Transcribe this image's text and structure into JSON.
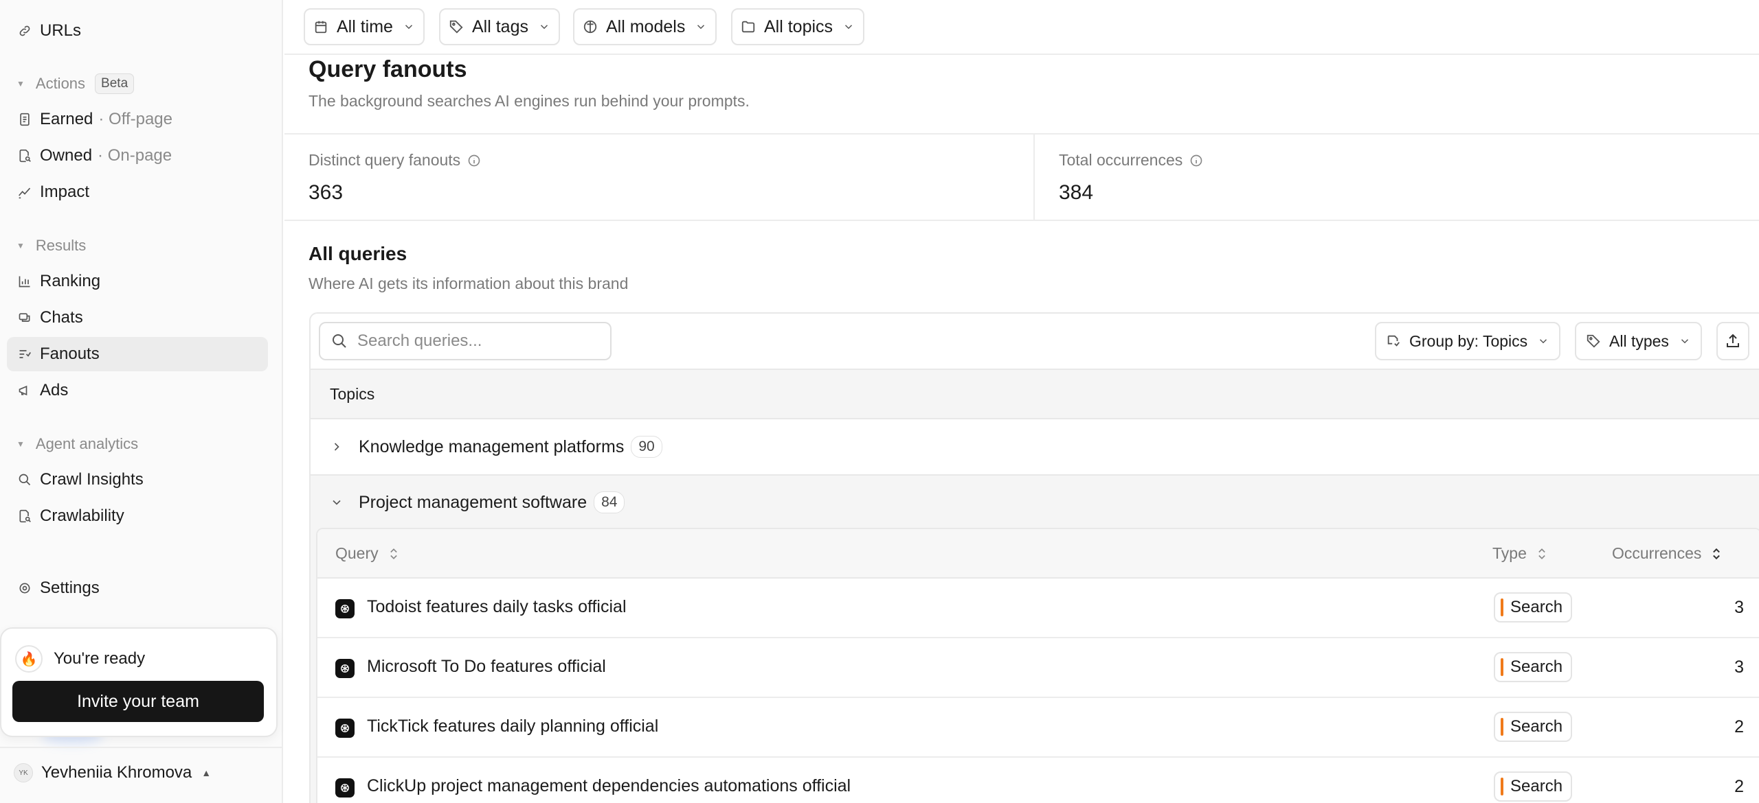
{
  "sidebar": {
    "urls": "URLs",
    "actions_head": "Actions",
    "beta": "Beta",
    "earned": "Earned",
    "earned_sub": "· Off-page",
    "owned": "Owned",
    "owned_sub": "· On-page",
    "impact": "Impact",
    "results_head": "Results",
    "ranking": "Ranking",
    "chats": "Chats",
    "fanouts": "Fanouts",
    "ads": "Ads",
    "agent_head": "Agent analytics",
    "crawl_insights": "Crawl Insights",
    "crawlability": "Crawlability",
    "settings": "Settings",
    "ready": "You're ready",
    "invite": "Invite your team",
    "user_initials": "YK",
    "user_name": "Yevheniia Khromova"
  },
  "filters": {
    "time": "All time",
    "tags": "All tags",
    "models": "All models",
    "topics": "All topics"
  },
  "page": {
    "title": "Query fanouts",
    "subtitle": "The background searches AI engines run behind your prompts."
  },
  "stats": {
    "distinct_label": "Distinct query fanouts",
    "distinct_value": "363",
    "total_label": "Total occurrences",
    "total_value": "384"
  },
  "queries": {
    "title": "All queries",
    "subtitle": "Where AI gets its information about this brand",
    "search_placeholder": "Search queries...",
    "group_by": "Group by: Topics",
    "all_types": "All types",
    "topics_header": "Topics",
    "groups": [
      {
        "name": "Knowledge management platforms",
        "count": "90"
      },
      {
        "name": "Project management software",
        "count": "84"
      }
    ],
    "columns": {
      "query": "Query",
      "type": "Type",
      "occurrences": "Occurrences"
    },
    "rows": [
      {
        "query": "Todoist features daily tasks official",
        "type": "Search",
        "occurrences": "3"
      },
      {
        "query": "Microsoft To Do features official",
        "type": "Search",
        "occurrences": "3"
      },
      {
        "query": "TickTick features daily planning official",
        "type": "Search",
        "occurrences": "2"
      },
      {
        "query": "ClickUp project management dependencies automations official",
        "type": "Search",
        "occurrences": "2"
      }
    ]
  },
  "colors": {
    "accent_type_bar": "#f07a1a",
    "primary_button": "#161616",
    "active_nav": "#ececec"
  }
}
